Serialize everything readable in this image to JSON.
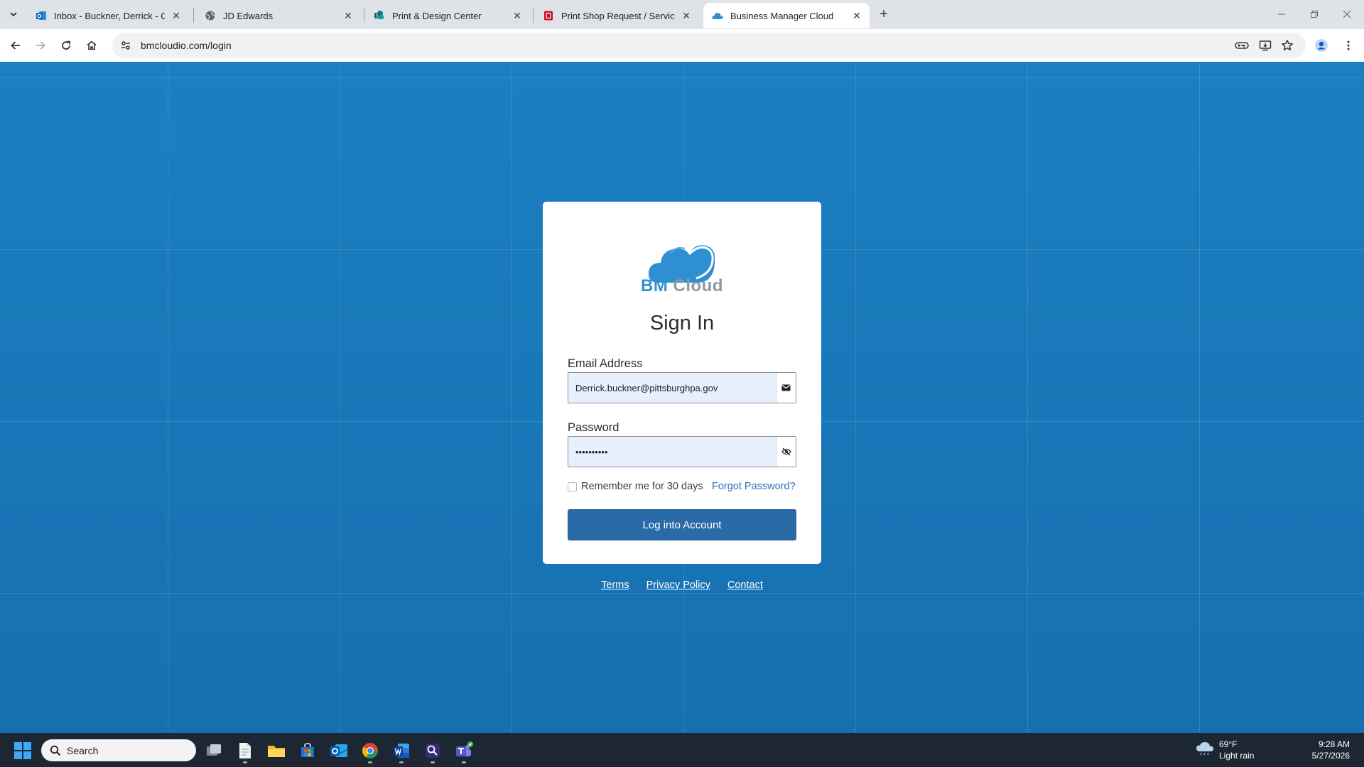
{
  "browser": {
    "tabs": [
      {
        "title": "Inbox - Buckner, Derrick - Outlook",
        "favicon": "outlook-icon",
        "active": false
      },
      {
        "title": "JD Edwards",
        "favicon": "globe-icon",
        "active": false
      },
      {
        "title": "Print & Design Center",
        "favicon": "sharepoint-icon",
        "active": false
      },
      {
        "title": "Print Shop Request / Service Catalog",
        "favicon": "form-icon",
        "active": false
      },
      {
        "title": "Business Manager Cloud",
        "favicon": "bm-cloud-icon",
        "active": true
      }
    ],
    "close_glyph": "✕",
    "new_tab_glyph": "+",
    "url": "bmcloudio.com/login"
  },
  "login": {
    "brand_bm": "BM",
    "brand_cloud": "Cloud",
    "title": "Sign In",
    "email_label": "Email Address",
    "email_value": "Derrick.buckner@pittsburghpa.gov",
    "password_label": "Password",
    "password_value": "••••••••••",
    "remember_label": "Remember me for 30 days",
    "forgot_label": "Forgot Password?",
    "submit_label": "Log into Account"
  },
  "footer": {
    "terms": "Terms",
    "privacy": "Privacy Policy",
    "contact": "Contact"
  },
  "taskbar": {
    "search_placeholder": "Search",
    "weather_temp": "69°F",
    "weather_desc": "Light rain",
    "time": "9:28 AM",
    "date": "5/27/2026"
  },
  "colors": {
    "page_background": "#1b7dbd",
    "login_button": "#2b6aa8",
    "link": "#2b72b8",
    "brand_blue": "#2f8fd3",
    "brand_gray": "#8a9aa5"
  }
}
